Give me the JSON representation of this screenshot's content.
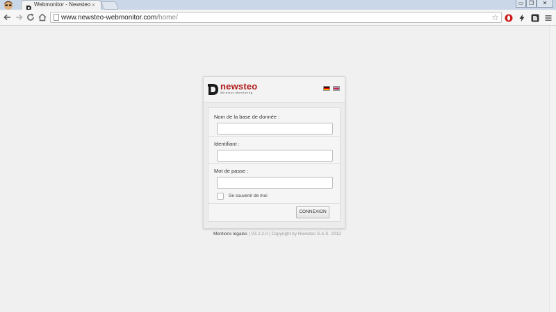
{
  "browser": {
    "tab": {
      "title": "Webmonitor - Newsteo",
      "close_glyph": "×"
    },
    "window_buttons": [
      "▭",
      "❐",
      "✕"
    ],
    "url": {
      "host": "www.newsteo-webmonitor.com",
      "path": "/home/"
    },
    "icons": {
      "back": "back-arrow-icon",
      "forward": "forward-arrow-icon",
      "reload": "reload-icon",
      "home": "home-icon",
      "bookmark": "bookmark-star-icon",
      "menu": "menu-icon"
    }
  },
  "brand": {
    "name": "newsteo",
    "tagline": "Wireless Monitoring",
    "color": "#b01b1b"
  },
  "languages": [
    "de",
    "en"
  ],
  "form": {
    "database_label": "Nom de la base de donnée :",
    "database_value": "",
    "username_label": "Identifiant :",
    "username_value": "",
    "password_label": "Mot de passe :",
    "password_value": "",
    "remember_label": "Se souvenir de moi",
    "submit_label": "CONNEXION"
  },
  "footer": {
    "legal_link": "Mentions légales",
    "version": "| V3.2.2.0 | Copyright by Newsteo S.A.S. 2012"
  }
}
